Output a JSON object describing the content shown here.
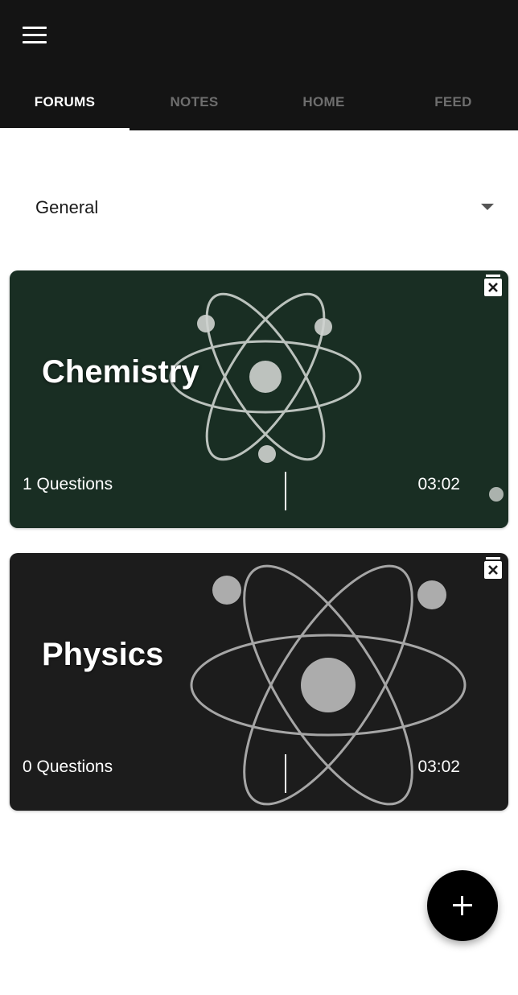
{
  "tabs": [
    {
      "label": "FORUMS",
      "active": true
    },
    {
      "label": "NOTES",
      "active": false
    },
    {
      "label": "HOME",
      "active": false
    },
    {
      "label": "FEED",
      "active": false
    }
  ],
  "category_select": {
    "value": "General"
  },
  "forums": [
    {
      "title": "Chemistry",
      "questions": "1 Questions",
      "time": "03:02",
      "background_color": "#1f3a2c"
    },
    {
      "title": "Physics",
      "questions": "0 Questions",
      "time": "03:02",
      "background_color": "#1c1c1c"
    }
  ],
  "colors": {
    "app_bar": "#141414",
    "tab_active": "#ffffff",
    "tab_inactive": "#6e6e6e",
    "fab": "#000000"
  },
  "icons": {
    "menu": "menu-icon",
    "dropdown": "chevron-down-icon",
    "delete": "delete-icon",
    "add": "plus-icon"
  }
}
